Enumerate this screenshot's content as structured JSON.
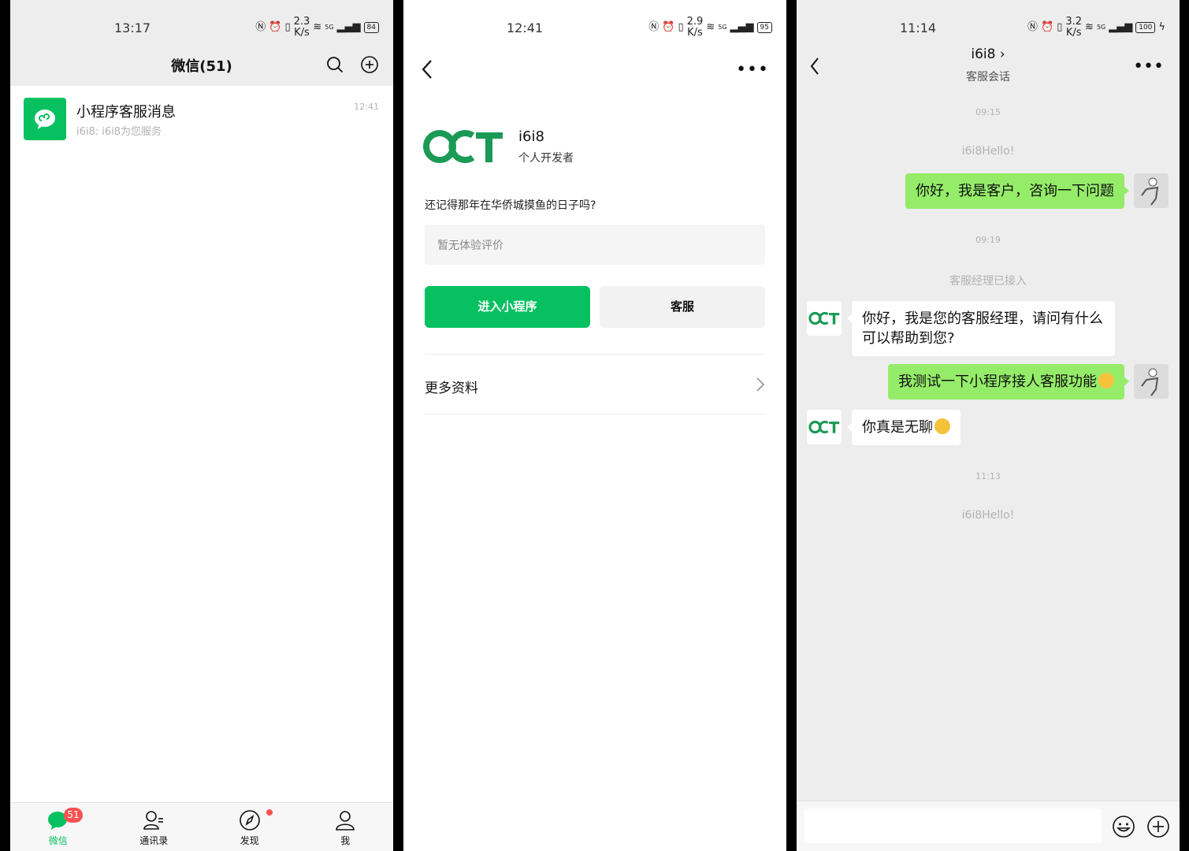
{
  "phone1": {
    "status": {
      "time": "13:17",
      "speed_top": "2.3",
      "speed_bottom": "K/s",
      "net": "5G",
      "battery": "84"
    },
    "header": {
      "title": "微信(51)"
    },
    "chat": {
      "name": "小程序客服消息",
      "preview": "i6i8: i6i8为您服务",
      "time": "12:41"
    },
    "tabs": [
      {
        "label": "微信",
        "badge": "51"
      },
      {
        "label": "通讯录"
      },
      {
        "label": "发现"
      },
      {
        "label": "我"
      }
    ]
  },
  "phone2": {
    "status": {
      "time": "12:41",
      "speed_top": "2.9",
      "speed_bottom": "K/s",
      "net": "5G",
      "battery": "95"
    },
    "profile": {
      "logo_text": "OCT",
      "name": "i6i8",
      "type": "个人开发者"
    },
    "description": "还记得那年在华侨城摸鱼的日子吗?",
    "review_placeholder": "暂无体验评价",
    "buttons": {
      "enter": "进入小程序",
      "service": "客服"
    },
    "more_info": "更多资料"
  },
  "phone3": {
    "status": {
      "time": "11:14",
      "speed_top": "3.2",
      "speed_bottom": "K/s",
      "net": "5G",
      "battery": "100"
    },
    "header": {
      "title": "i6i8",
      "subtitle": "客服会话"
    },
    "messages": [
      {
        "kind": "time",
        "text": "09:15"
      },
      {
        "kind": "system",
        "text": "i6i8Hello!"
      },
      {
        "kind": "me",
        "text": "你好，我是客户，咨询一下问题"
      },
      {
        "kind": "time",
        "text": "09:19"
      },
      {
        "kind": "system",
        "text": "客服经理已接入"
      },
      {
        "kind": "you",
        "text": "你好，我是您的客服经理，请问有什么可以帮助到您?"
      },
      {
        "kind": "me",
        "text": "我测试一下小程序接人客服功能"
      },
      {
        "kind": "you",
        "text": "你真是无聊"
      },
      {
        "kind": "time",
        "text": "11:13"
      },
      {
        "kind": "system",
        "text": "i6i8Hello!"
      }
    ]
  },
  "colors": {
    "brand": "#07c160",
    "bubble_me": "#95ec69",
    "badge": "#fa5151"
  }
}
